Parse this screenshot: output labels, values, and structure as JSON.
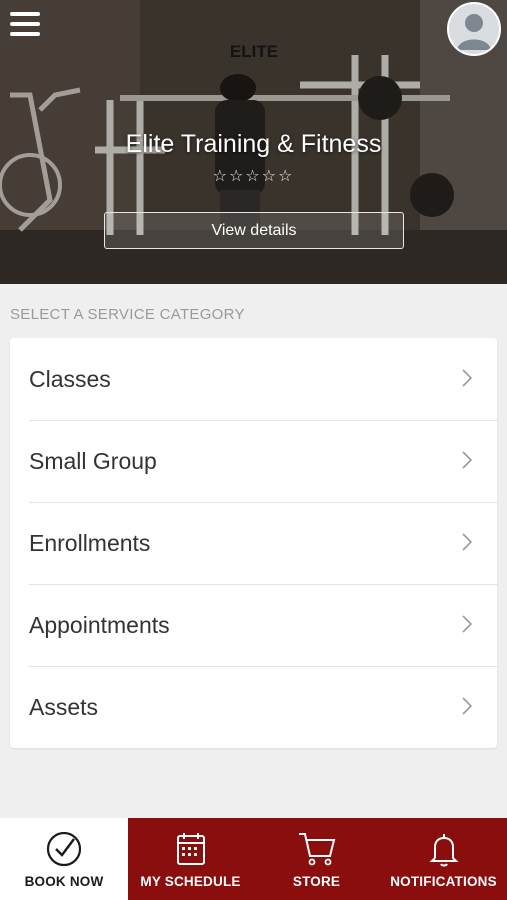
{
  "hero": {
    "logo_text": "ELITE",
    "title": "Elite Training & Fitness",
    "rating": "☆☆☆☆☆",
    "view_details_label": "View details"
  },
  "services": {
    "section_label": "SELECT A SERVICE CATEGORY",
    "items": [
      {
        "label": "Classes"
      },
      {
        "label": "Small Group"
      },
      {
        "label": "Enrollments"
      },
      {
        "label": "Appointments"
      },
      {
        "label": "Assets"
      }
    ]
  },
  "tabs": [
    {
      "label": "BOOK NOW",
      "icon": "check-circle-icon",
      "active": true
    },
    {
      "label": "MY SCHEDULE",
      "icon": "calendar-icon",
      "active": false
    },
    {
      "label": "STORE",
      "icon": "cart-icon",
      "active": false
    },
    {
      "label": "NOTIFICATIONS",
      "icon": "bell-icon",
      "active": false
    }
  ],
  "colors": {
    "tab_bar": "#8b0e0e",
    "active_tab": "#ffffff",
    "background": "#efefef"
  }
}
